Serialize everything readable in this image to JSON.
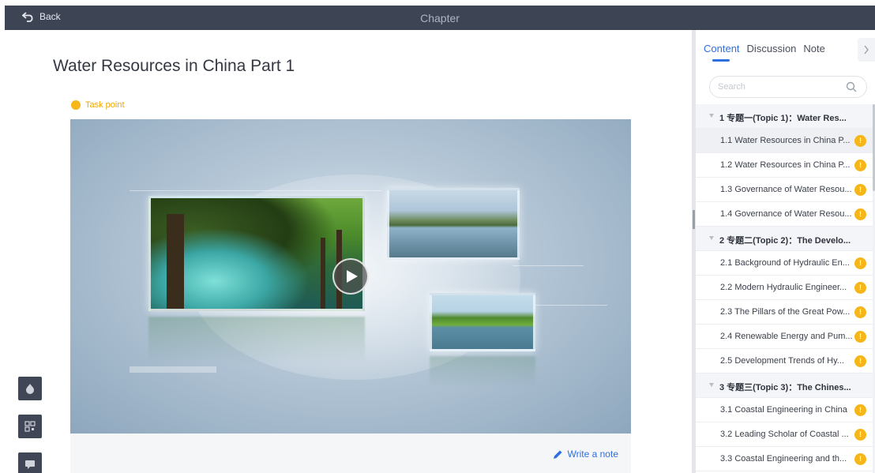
{
  "topbar": {
    "back_label": "Back",
    "title": "Chapter"
  },
  "main": {
    "title": "Water Resources in China Part 1",
    "task_point": "Task point",
    "write_note": "Write a note"
  },
  "panel": {
    "tabs": [
      {
        "label": "Content",
        "active": true
      },
      {
        "label": "Discussion",
        "active": false
      },
      {
        "label": "Note",
        "active": false
      }
    ],
    "search_placeholder": "Search",
    "badge_symbol": "!",
    "toc": [
      {
        "type": "chapter",
        "label": "1 专题一(Topic 1)：Water Res..."
      },
      {
        "type": "section",
        "label": "1.1 Water Resources in China P...",
        "selected": true
      },
      {
        "type": "section",
        "label": "1.2 Water Resources in China P..."
      },
      {
        "type": "section",
        "label": "1.3 Governance of Water Resou..."
      },
      {
        "type": "section",
        "label": "1.4 Governance of Water Resou..."
      },
      {
        "type": "chapter",
        "label": "2 专题二(Topic 2)：The Develo..."
      },
      {
        "type": "section",
        "label": "2.1 Background of Hydraulic En..."
      },
      {
        "type": "section",
        "label": "2.2 Modern Hydraulic Engineer..."
      },
      {
        "type": "section",
        "label": "2.3 The Pillars of the Great Pow..."
      },
      {
        "type": "section",
        "label": "2.4 Renewable Energy and Pum..."
      },
      {
        "type": "section",
        "label": "2.5 Development Trends of Hy..."
      },
      {
        "type": "chapter",
        "label": "3 专题三(Topic 3)：The Chines..."
      },
      {
        "type": "section",
        "label": "3.1 Coastal Engineering in China"
      },
      {
        "type": "section",
        "label": "3.2 Leading Scholar of Coastal ..."
      },
      {
        "type": "section",
        "label": "3.3 Coastal Engineering and th..."
      }
    ]
  },
  "colors": {
    "accent": "#2f6fdf",
    "task": "#f7b618",
    "topbar": "#3d4454"
  }
}
